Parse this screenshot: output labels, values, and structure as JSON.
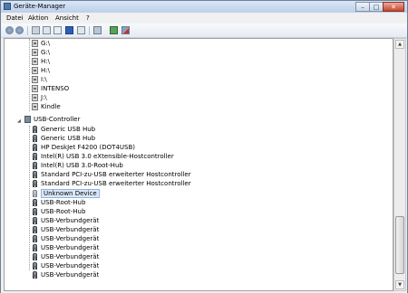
{
  "window": {
    "title": "Geräte-Manager"
  },
  "caption_buttons": {
    "minimize": "–",
    "maximize": "□",
    "close": "✕"
  },
  "menu": {
    "items": [
      "Datei",
      "Aktion",
      "Ansicht",
      "?"
    ]
  },
  "toolbar": {
    "icons": [
      "back-icon",
      "forward-icon",
      "view-icon",
      "properties-icon",
      "help-icon",
      "device-view-icon",
      "scan-hardware-icon",
      "update-driver-icon",
      "uninstall-icon"
    ]
  },
  "tree": {
    "drives": [
      "G:\\",
      "G:\\",
      "H:\\",
      "H:\\",
      "I:\\",
      "INTENSO",
      "J:\\",
      "Kindle"
    ],
    "usb_controller": {
      "label": "USB-Controller",
      "items": [
        "Generic USB Hub",
        "Generic USB Hub",
        "HP DeskJet F4200 (DOT4USB)",
        "Intel(R) USB 3.0 eXtensible-Hostcontroller",
        "Intel(R) USB 3.0-Root-Hub",
        "Standard PCI-zu-USB erweiterter Hostcontroller",
        "Standard PCI-zu-USB erweiterter Hostcontroller",
        "Unknown Device",
        "USB-Root-Hub",
        "USB-Root-Hub",
        "USB-Verbundgerät",
        "USB-Verbundgerät",
        "USB-Verbundgerät",
        "USB-Verbundgerät",
        "USB-Verbundgerät",
        "USB-Verbundgerät",
        "USB-Verbundgerät"
      ],
      "selected_index": 7
    }
  }
}
